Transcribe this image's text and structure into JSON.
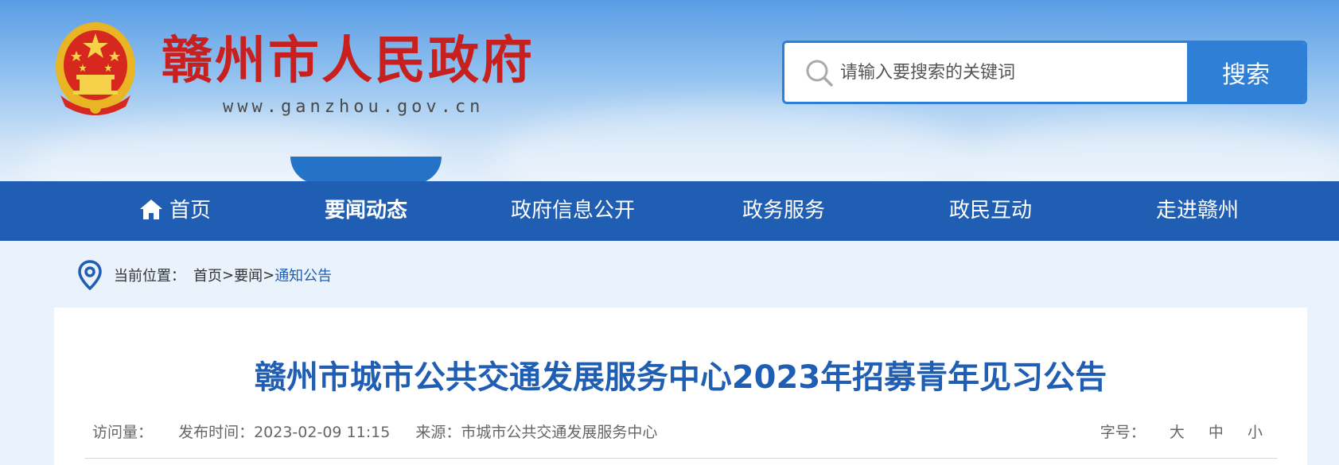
{
  "header": {
    "site_name": "赣州市人民政府",
    "site_url": "www.ganzhou.gov.cn"
  },
  "search": {
    "placeholder": "请输入要搜索的关键词",
    "button_label": "搜索"
  },
  "nav": {
    "items": [
      {
        "label": "首页",
        "icon": "home-icon"
      },
      {
        "label": "要闻动态",
        "active": true
      },
      {
        "label": "政府信息公开"
      },
      {
        "label": "政务服务"
      },
      {
        "label": "政民互动"
      },
      {
        "label": "走进赣州"
      }
    ]
  },
  "breadcrumb": {
    "prefix": "当前位置：",
    "items": [
      "首页",
      "要闻"
    ],
    "separator": ">",
    "current": "通知公告"
  },
  "article": {
    "title": "赣州市城市公共交通发展服务中心2023年招募青年见习公告",
    "visits_label": "访问量：",
    "publish_label": "发布时间：",
    "publish_time": "2023-02-09 11:15",
    "source_label": "来源：",
    "source": "市城市公共交通发展服务中心",
    "font_size_label": "字号：",
    "font_sizes": [
      "大",
      "中",
      "小"
    ]
  },
  "colors": {
    "nav_bg": "#1f5eb3",
    "accent": "#2f7fd6",
    "site_name": "#c8201e"
  }
}
